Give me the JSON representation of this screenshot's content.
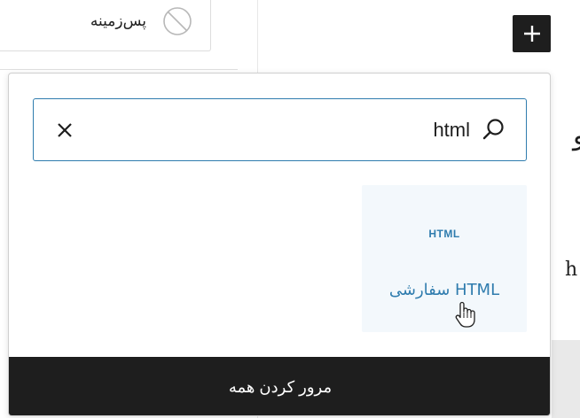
{
  "sidebar": {
    "background_style_label": "پس‌زمینه",
    "none_icon": "none-circle-slash-icon"
  },
  "editor": {
    "add_block_icon": "plus-icon",
    "canvas_glyph_1": "و",
    "canvas_glyph_2": "h"
  },
  "inserter": {
    "search": {
      "value": "html",
      "clear_icon": "close-icon",
      "search_icon": "search-icon"
    },
    "results": [
      {
        "icon_text": "HTML",
        "title": "HTML سفارشی"
      }
    ],
    "browse_all_label": "مرور کردن همه"
  },
  "colors": {
    "accent": "#2f7cae",
    "dark": "#1e1e1e",
    "result_bg": "#f3f8fc"
  }
}
